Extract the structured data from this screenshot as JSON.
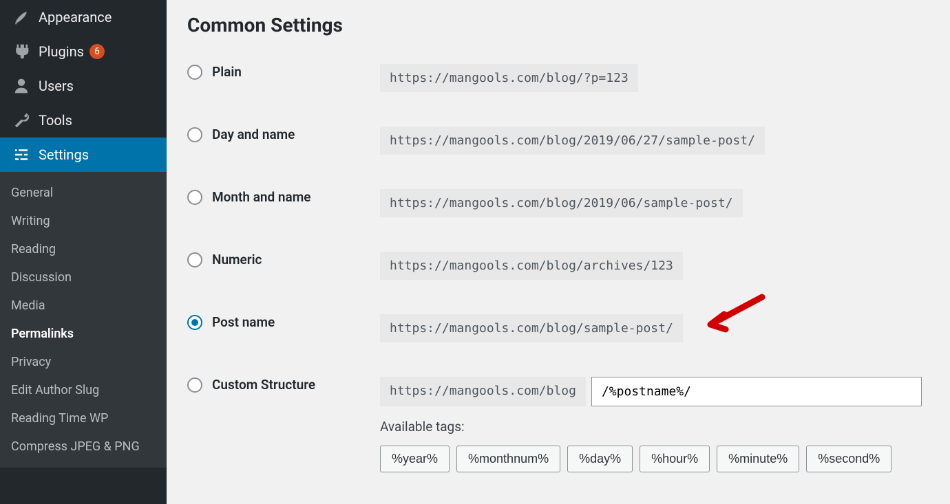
{
  "sidebar": {
    "appearance": "Appearance",
    "plugins": "Plugins",
    "plugins_badge": "6",
    "users": "Users",
    "tools": "Tools",
    "settings": "Settings",
    "sub": {
      "general": "General",
      "writing": "Writing",
      "reading": "Reading",
      "discussion": "Discussion",
      "media": "Media",
      "permalinks": "Permalinks",
      "privacy": "Privacy",
      "edit_author_slug": "Edit Author Slug",
      "reading_time_wp": "Reading Time WP",
      "compress_jpeg_png": "Compress JPEG & PNG"
    }
  },
  "main": {
    "heading": "Common Settings",
    "options": {
      "plain": {
        "label": "Plain",
        "url": "https://mangools.com/blog/?p=123"
      },
      "dayname": {
        "label": "Day and name",
        "url": "https://mangools.com/blog/2019/06/27/sample-post/"
      },
      "monthname": {
        "label": "Month and name",
        "url": "https://mangools.com/blog/2019/06/sample-post/"
      },
      "numeric": {
        "label": "Numeric",
        "url": "https://mangools.com/blog/archives/123"
      },
      "postname": {
        "label": "Post name",
        "url": "https://mangools.com/blog/sample-post/"
      },
      "custom": {
        "label": "Custom Structure",
        "base": "https://mangools.com/blog",
        "value": "/%postname%/"
      }
    },
    "available_tags_label": "Available tags:",
    "tags": [
      "%year%",
      "%monthnum%",
      "%day%",
      "%hour%",
      "%minute%",
      "%second%"
    ]
  }
}
